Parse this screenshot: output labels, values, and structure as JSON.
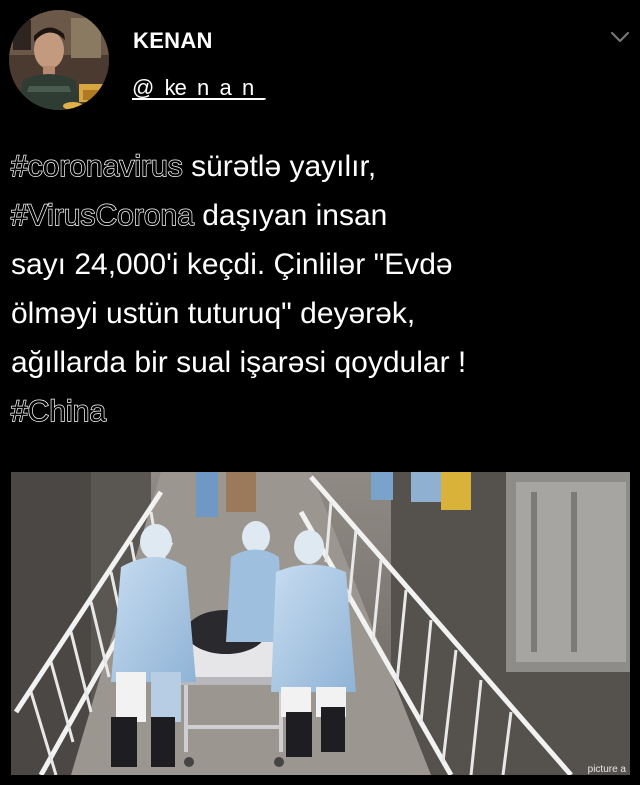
{
  "user": {
    "display_name": "KENAN",
    "handle": "@_ke_n_a_n_",
    "avatar_icon": "user-avatar-photo"
  },
  "menu": {
    "icon": "chevron-down-icon",
    "color": "#777777"
  },
  "tweet": {
    "lines": [
      [
        {
          "text": "#coronavirus",
          "hashtag": true
        },
        {
          "text": " sürətlə yayılır,",
          "hashtag": false
        }
      ],
      [
        {
          "text": "#VirusCorona",
          "hashtag": true
        },
        {
          "text": " daşıyan insan",
          "hashtag": false
        }
      ],
      [
        {
          "text": "sayı  24,000'i keçdi. Çinlilər \"Evdə",
          "hashtag": false
        }
      ],
      [
        {
          "text": "ölməyi ustün tuturuq\" deyərək,",
          "hashtag": false
        }
      ],
      [
        {
          "text": "ağıllarda bir sual işarəsi qoydular !",
          "hashtag": false
        }
      ],
      [
        {
          "text": "#China",
          "hashtag": true
        }
      ]
    ]
  },
  "media": {
    "watermark": "picture a"
  },
  "colors": {
    "background": "#000000",
    "text": "#ffffff"
  }
}
